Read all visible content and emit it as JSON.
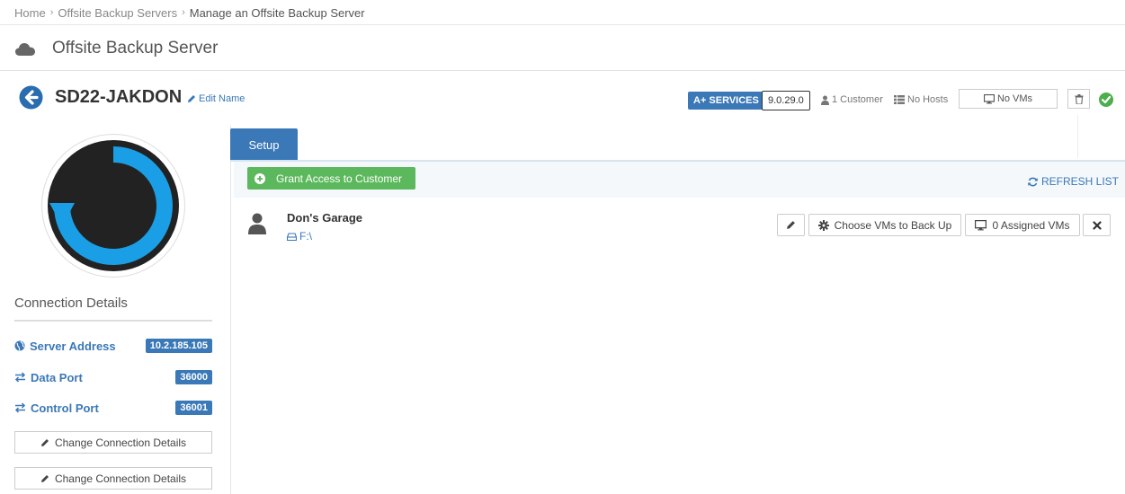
{
  "breadcrumb": {
    "home": "Home",
    "servers": "Offsite Backup Servers",
    "current": "Manage an Offsite Backup Server"
  },
  "page": {
    "title": "Offsite Backup Server"
  },
  "server": {
    "name": "SD22-JAKDON",
    "edit_name_label": "Edit Name",
    "services_badge": "A+ SERVICES",
    "version": "9.0.29.0",
    "customers": "1 Customer",
    "hosts": "No Hosts",
    "vms_button": "No VMs",
    "status_color": "#4cae4c"
  },
  "connection": {
    "title": "Connection Details",
    "rows": [
      {
        "label": "Server Address",
        "value": "10.2.185.105"
      },
      {
        "label": "Data Port",
        "value": "36000"
      },
      {
        "label": "Control Port",
        "value": "36001"
      }
    ],
    "change_buttons": [
      "Change Connection Details",
      "Change Connection Details"
    ]
  },
  "tabs": [
    {
      "label": "Setup",
      "active": true
    }
  ],
  "toolbar": {
    "grant_label": "Grant Access to Customer",
    "refresh_label": "REFRESH LIST"
  },
  "customer_list": [
    {
      "name": "Don's Garage",
      "drive": "F:\\",
      "choose_vms_label": "Choose VMs to Back Up",
      "assigned_vms_label": "0 Assigned VMs"
    }
  ],
  "colors": {
    "primary": "#3a78b7",
    "success": "#5cb85c",
    "logo_blue": "#1a9ee5",
    "logo_dark": "#222222"
  }
}
